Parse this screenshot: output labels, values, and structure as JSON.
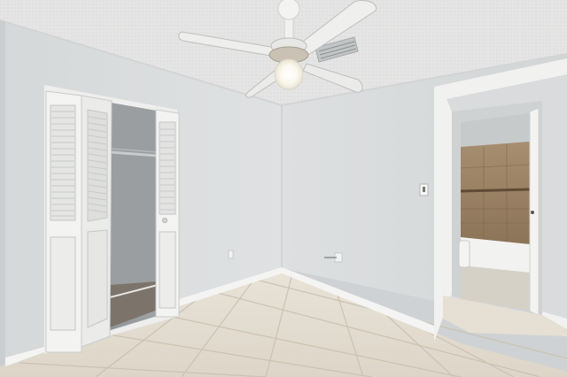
{
  "scene": {
    "kind": "photo",
    "subject": "empty bedroom",
    "features": [
      "ceiling-fan",
      "louvered-bifold-closet-doors",
      "open-doorway-to-bathroom",
      "tile-floor",
      "air-vent",
      "light-switch",
      "wall-outlet"
    ]
  },
  "colors": {
    "wall": "#dcdedf",
    "wall_shadow": "#c9cccd",
    "ceiling": "#e3e4e3",
    "floor_tile": "#e6dfd3",
    "grout": "#cfc6b8",
    "trim": "#f4f4f2",
    "closet_interior": "#8f9396",
    "bath_tile": "#9c8468"
  }
}
